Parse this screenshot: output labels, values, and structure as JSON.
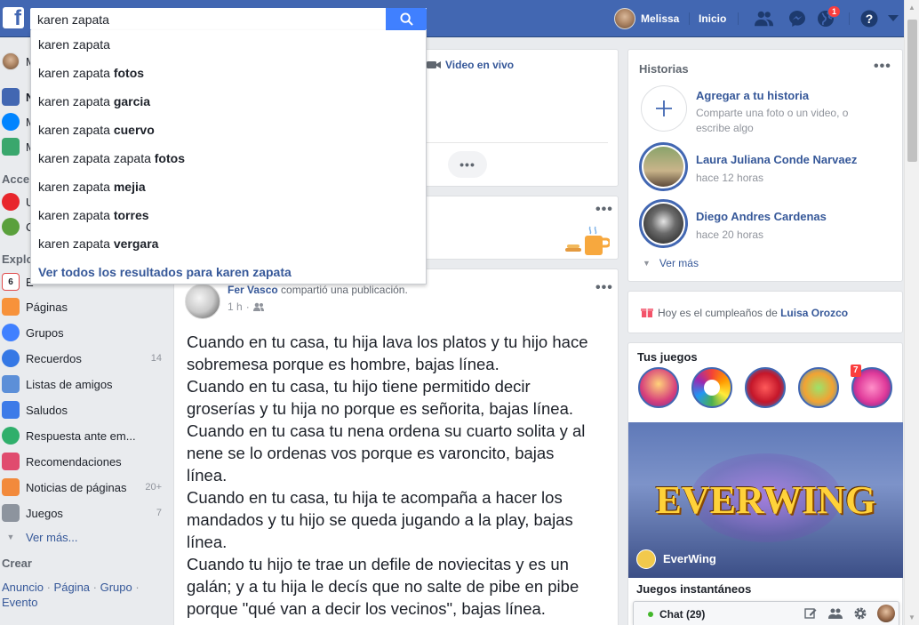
{
  "topbar": {
    "search_value": "karen zapata",
    "profile_name": "Melissa",
    "home_label": "Inicio",
    "notifications_count": "1",
    "colors": {
      "brand": "#4267b2",
      "search_button": "#4080ff"
    }
  },
  "search_dropdown": {
    "suggestions": [
      {
        "prefix": "karen zapata",
        "bold": ""
      },
      {
        "prefix": "karen zapata ",
        "bold": "fotos"
      },
      {
        "prefix": "karen zapata ",
        "bold": "garcia"
      },
      {
        "prefix": "karen zapata ",
        "bold": "cuervo"
      },
      {
        "prefix": "karen zapata zapata ",
        "bold": "fotos"
      },
      {
        "prefix": "karen zapata ",
        "bold": "mejia"
      },
      {
        "prefix": "karen zapata ",
        "bold": "torres"
      },
      {
        "prefix": "karen zapata ",
        "bold": "vergara"
      }
    ],
    "see_all": "Ver todos los resultados para karen zapata"
  },
  "left_sidebar": {
    "partial_items": [
      "M",
      "N",
      "M",
      "M"
    ],
    "section_shortcuts": "Acce",
    "shortcut_partial": [
      "U",
      "C"
    ],
    "section_explore": "Explo",
    "explore_first_partial": "E",
    "items": [
      {
        "label": "Páginas",
        "count": ""
      },
      {
        "label": "Grupos",
        "count": ""
      },
      {
        "label": "Recuerdos",
        "count": "14"
      },
      {
        "label": "Listas de amigos",
        "count": ""
      },
      {
        "label": "Saludos",
        "count": ""
      },
      {
        "label": "Respuesta ante em...",
        "count": ""
      },
      {
        "label": "Recomendaciones",
        "count": ""
      },
      {
        "label": "Noticias de páginas",
        "count": "20+"
      },
      {
        "label": "Juegos",
        "count": "7"
      }
    ],
    "see_more": "Ver más...",
    "create_title": "Crear",
    "create_links": [
      "Anuncio",
      "Página",
      "Grupo",
      "Evento"
    ]
  },
  "composer": {
    "live_video": "Video en vivo"
  },
  "post": {
    "author": "Fer Vasco",
    "action": " compartió una publicación.",
    "time": "1 h",
    "text_lines": [
      "Cuando en tu casa, tu hija lava los platos y tu hijo hace",
      "sobremesa porque es hombre, bajas línea.",
      "Cuando en tu casa, tu hijo tiene permitido decir",
      "groserías y tu hija no porque es señorita, bajas línea.",
      "Cuando en tu casa tu nena ordena su cuarto solita y al",
      "nene se lo ordenas vos porque es varoncito, bajas",
      "línea.",
      "Cuando en tu casa, tu hija te acompaña a hacer los",
      "mandados y tu hijo se queda jugando a la play, bajas",
      "línea.",
      "Cuando tu hijo te trae un defile de noviecitas y es un",
      "galán; y a tu hija le decís que no salte de pibe en pibe",
      "porque \"qué van a decir los vecinos\", bajas línea."
    ]
  },
  "right_sidebar": {
    "stories_title": "Historias",
    "add_story_title": "Agregar a tu historia",
    "add_story_sub": "Comparte una foto o un video, o escribe algo",
    "stories": [
      {
        "name": "Laura Juliana Conde Narvaez",
        "time": "hace 12 horas"
      },
      {
        "name": "Diego Andres Cardenas",
        "time": "hace 20 horas"
      }
    ],
    "see_more": "Ver más",
    "birthday_prefix": "Hoy es el cumpleaños de ",
    "birthday_name": "Luisa Orozco",
    "games_title": "Tus juegos",
    "game_badge": "7",
    "featured_game_title": "EVERWING",
    "featured_game_name": "EverWing",
    "instant_games_title": "Juegos instantáneos",
    "chat_label": "Chat (29)"
  }
}
